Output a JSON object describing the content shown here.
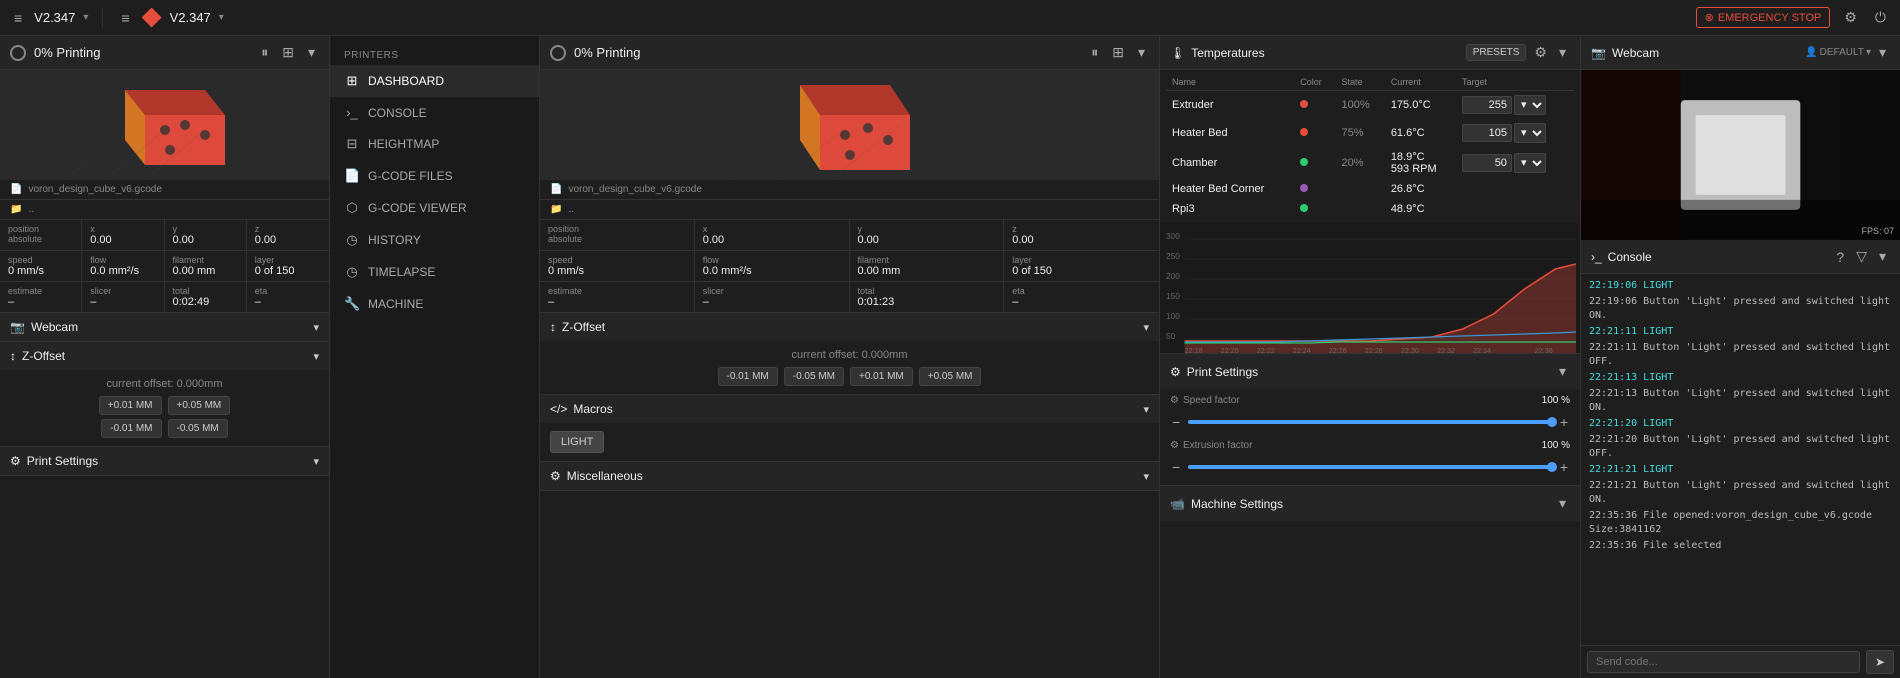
{
  "topbar": {
    "left": {
      "menu_icon": "≡",
      "logo": "",
      "version": "V2.347",
      "chevron": "▾"
    },
    "right": {
      "emergency_label": "EMERGENCY STOP",
      "settings_icon": "⚙",
      "power_icon": "⏻",
      "error_icon": "⊗"
    }
  },
  "left_status": {
    "print_percent": "0%",
    "print_label": "Printing",
    "pause_icon": "⏸",
    "grid_icon": "⊞",
    "expand_icon": "▾",
    "file": "voron_design_cube_v6.gcode",
    "folder": "..",
    "position": {
      "label": "Position",
      "sub": "absolute",
      "x": "0.00",
      "y": "0.00",
      "z": "0.00"
    },
    "speed": {
      "label": "Speed",
      "value": "0 mm/s"
    },
    "flow": {
      "label": "Flow",
      "value": "0.0 mm²/s"
    },
    "filament": {
      "label": "Filament",
      "value": "0.00 mm"
    },
    "layer": {
      "label": "Layer",
      "value": "0 of 150"
    },
    "estimate_label": "Estimate",
    "estimate_val": "–",
    "slicer_label": "Slicer",
    "slicer_val": "–",
    "total_label": "Total",
    "total_val": "0:02:49",
    "eta_label": "ETA",
    "eta_val": "–"
  },
  "sidebar": {
    "printers_label": "PRINTERS",
    "items": [
      {
        "id": "dashboard",
        "label": "DASHBOARD",
        "icon": "⊞",
        "active": true
      },
      {
        "id": "console",
        "label": "CONSOLE",
        "icon": "›_"
      },
      {
        "id": "heightmap",
        "label": "HEIGHTMAP",
        "icon": "⊟"
      },
      {
        "id": "gcode-files",
        "label": "G-CODE FILES",
        "icon": "📄"
      },
      {
        "id": "gcode-viewer",
        "label": "G-CODE VIEWER",
        "icon": "⬡"
      },
      {
        "id": "history",
        "label": "HISTORY",
        "icon": "◷"
      },
      {
        "id": "timelapse",
        "label": "TIMELAPSE",
        "icon": "◷"
      },
      {
        "id": "machine",
        "label": "MACHINE",
        "icon": "🔧"
      }
    ]
  },
  "center_status": {
    "print_percent": "0%",
    "print_label": "Printing",
    "file": "voron_design_cube_v6.gcode",
    "folder": "..",
    "position": {
      "label": "Position",
      "sub": "absolute",
      "x_label": "X",
      "x": "0.00",
      "y_label": "Y",
      "y": "0.00",
      "z_label": "Z",
      "z": "0.00"
    },
    "speed_label": "Speed",
    "speed_val": "0 mm/s",
    "flow_label": "Flow",
    "flow_val": "0.0 mm²/s",
    "filament_label": "Filament",
    "filament_val": "0.00 mm",
    "layer_label": "Layer",
    "layer_val": "0 of 150",
    "estimate_label": "Estimate",
    "estimate_val": "–",
    "slicer_label": "Slicer",
    "slicer_val": "–",
    "total_label": "Total",
    "total_val": "0:01:23",
    "eta_label": "ETA",
    "eta_val": "–"
  },
  "zoffset": {
    "title": "Z-Offset",
    "current_label": "current offset: 0.000mm",
    "btn_minus_001": "-0.01 MM",
    "btn_minus_005": "-0.05 MM",
    "btn_plus_001": "+0.01 MM",
    "btn_plus_005": "+0.05 MM"
  },
  "macros": {
    "title": "Macros",
    "light_btn": "LIGHT"
  },
  "misc": {
    "title": "Miscellaneous"
  },
  "temperatures": {
    "title": "Temperatures",
    "presets_label": "PRESETS",
    "cols": [
      "Name",
      "Color",
      "State",
      "Current",
      "Target"
    ],
    "rows": [
      {
        "name": "Extruder",
        "icon": "extruder",
        "dot_color": "#e74c3c",
        "state": "100%",
        "current": "175.0°C",
        "target": "255"
      },
      {
        "name": "Heater Bed",
        "icon": "bed",
        "dot_color": "#e74c3c",
        "state": "75%",
        "current": "61.6°C",
        "target": "105"
      },
      {
        "name": "Chamber",
        "icon": "fan",
        "dot_color": "#2ecc71",
        "state": "20%",
        "current": "18.9°C\n593 RPM",
        "target": "50"
      },
      {
        "name": "Heater Bed Corner",
        "icon": "corner",
        "dot_color": "#9b59b6",
        "state": "",
        "current": "26.8°C",
        "target": ""
      },
      {
        "name": "Rpi3",
        "icon": "chip",
        "dot_color": "#2ecc71",
        "state": "",
        "current": "48.9°C",
        "target": ""
      }
    ],
    "chart": {
      "y_ticks": [
        "300",
        "250",
        "200",
        "150",
        "100",
        "50"
      ],
      "x_ticks": [
        "22:18",
        "22:20",
        "22:22",
        "22:24",
        "22:26",
        "22:28",
        "22:30",
        "22:32",
        "22:34",
        "22:36"
      ]
    }
  },
  "print_settings": {
    "title": "Print Settings",
    "speed_label": "Speed factor",
    "speed_val": "100 %",
    "speed_pct": 100,
    "extrusion_label": "Extrusion factor",
    "extrusion_val": "100 %",
    "extrusion_pct": 100
  },
  "machine_settings": {
    "title": "Machine Settings"
  },
  "webcam": {
    "title": "Webcam",
    "default_label": "DEFAULT",
    "fps_label": "FPS: 07"
  },
  "console_panel": {
    "title": "Console",
    "help_icon": "?",
    "filter_icon": "▽",
    "expand_icon": "▾",
    "placeholder": "Send code...",
    "send_icon": "➤",
    "log": [
      {
        "text": "22:19:06  LIGHT",
        "type": "cyan"
      },
      {
        "text": "22:19:06  Button 'Light' pressed and switched light ON.",
        "type": "normal"
      },
      {
        "text": "22:21:11  LIGHT",
        "type": "cyan"
      },
      {
        "text": "22:21:11  Button 'Light' pressed and switched light OFF.",
        "type": "normal"
      },
      {
        "text": "22:21:13  LIGHT",
        "type": "cyan"
      },
      {
        "text": "22:21:13  Button 'Light' pressed and switched light ON.",
        "type": "normal"
      },
      {
        "text": "22:21:20  LIGHT",
        "type": "cyan"
      },
      {
        "text": "22:21:20  Button 'Light' pressed and switched light OFF.",
        "type": "normal"
      },
      {
        "text": "22:21:21  LIGHT",
        "type": "cyan"
      },
      {
        "text": "22:21:21  Button 'Light' pressed and switched light ON.",
        "type": "normal"
      },
      {
        "text": "22:35:36  File opened:voron_design_cube_v6.gcode Size:3841162",
        "type": "normal"
      },
      {
        "text": "22:35:36  File selected",
        "type": "normal"
      }
    ]
  }
}
